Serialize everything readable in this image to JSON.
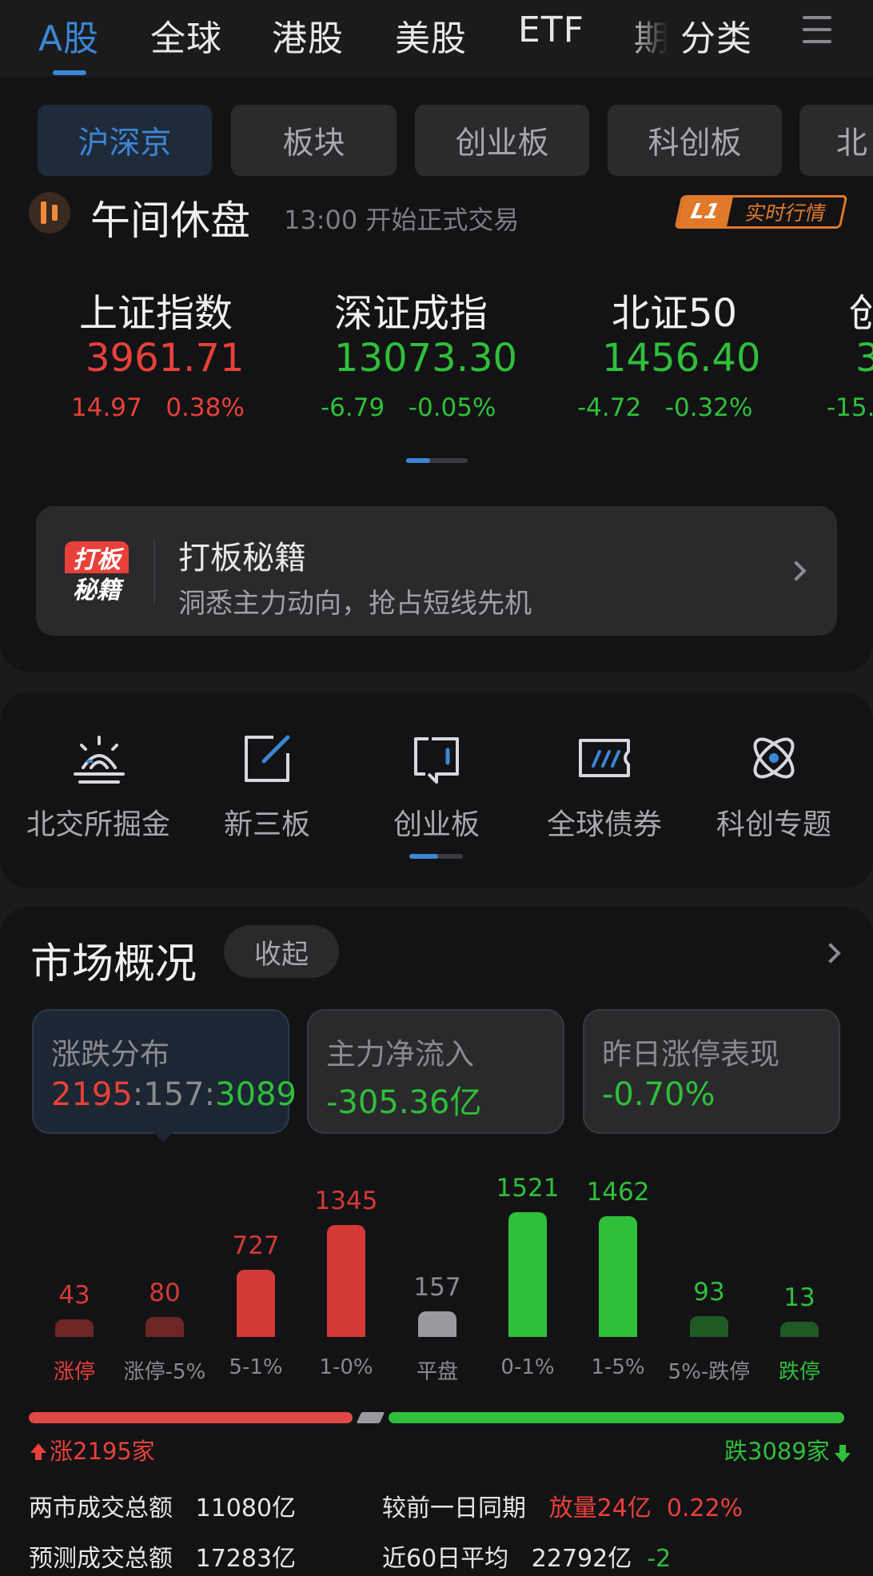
{
  "top_tabs": [
    "A股",
    "全球",
    "港股",
    "美股",
    "ETF",
    "期",
    "分类"
  ],
  "sub_tabs": [
    "沪深京",
    "板块",
    "创业板",
    "科创板",
    "北"
  ],
  "status": {
    "title": "午间休盘",
    "time": "13:00",
    "sub": "开始正式交易",
    "badge_l1": "L1",
    "badge_text": "实时行情"
  },
  "indices": [
    {
      "name": "上证指数",
      "value": "3961.71",
      "change": "14.97",
      "pct": "0.38%",
      "dir": "up"
    },
    {
      "name": "深证成指",
      "value": "13073.30",
      "change": "-6.79",
      "pct": "-0.05%",
      "dir": "down"
    },
    {
      "name": "北证50",
      "value": "1456.40",
      "change": "-4.72",
      "pct": "-0.32%",
      "dir": "down"
    },
    {
      "name": "创",
      "value": "3",
      "change": "-15.",
      "pct": "",
      "dir": "down"
    }
  ],
  "promo": {
    "logo_top": "打板",
    "logo_bottom": "秘籍",
    "title": "打板秘籍",
    "subtitle": "洞悉主力动向，抢占短线先机"
  },
  "quick_links": [
    {
      "label": "北交所掘金",
      "icon": "sunrise-icon"
    },
    {
      "label": "新三板",
      "icon": "edit-square-icon"
    },
    {
      "label": "创业板",
      "icon": "flip-card-icon"
    },
    {
      "label": "全球债券",
      "icon": "ticket-icon"
    },
    {
      "label": "科创专题",
      "icon": "atom-icon"
    }
  ],
  "market": {
    "title": "市场概况",
    "collapse_label": "收起",
    "cards": [
      {
        "title": "涨跌分布",
        "up": "2195",
        "flat": "157",
        "down": "3089",
        "sep": ":"
      },
      {
        "title": "主力净流入",
        "value": "-305.36亿"
      },
      {
        "title": "昨日涨停表现",
        "value": "-0.70%"
      }
    ],
    "distribution": [
      {
        "label": "涨停",
        "value": 43,
        "kind": "up"
      },
      {
        "label": "涨停-5%",
        "value": 80,
        "kind": "up"
      },
      {
        "label": "5-1%",
        "value": 727,
        "kind": "up"
      },
      {
        "label": "1-0%",
        "value": 1345,
        "kind": "up"
      },
      {
        "label": "平盘",
        "value": 157,
        "kind": "flat"
      },
      {
        "label": "0-1%",
        "value": 1521,
        "kind": "down"
      },
      {
        "label": "1-5%",
        "value": 1462,
        "kind": "down"
      },
      {
        "label": "5%-跌停",
        "value": 93,
        "kind": "down"
      },
      {
        "label": "跌停",
        "value": 13,
        "kind": "down"
      }
    ],
    "up_label": "涨2195家",
    "down_label": "跌3089家",
    "volume": {
      "total_label": "两市成交总额",
      "total_value": "11080亿",
      "compare_label": "较前一日同期",
      "compare_value": "放量24亿",
      "compare_pct": "0.22%",
      "forecast_label": "预测成交总额",
      "forecast_value": "17283亿",
      "avg_label": "近60日平均",
      "avg_value": "22792亿",
      "avg_pct": "-2"
    }
  },
  "colors": {
    "up": "#e8403a",
    "down": "#2fbf3a",
    "flat": "#8a8a8e",
    "accent": "#3b86d6",
    "badge": "#e07a2a"
  }
}
